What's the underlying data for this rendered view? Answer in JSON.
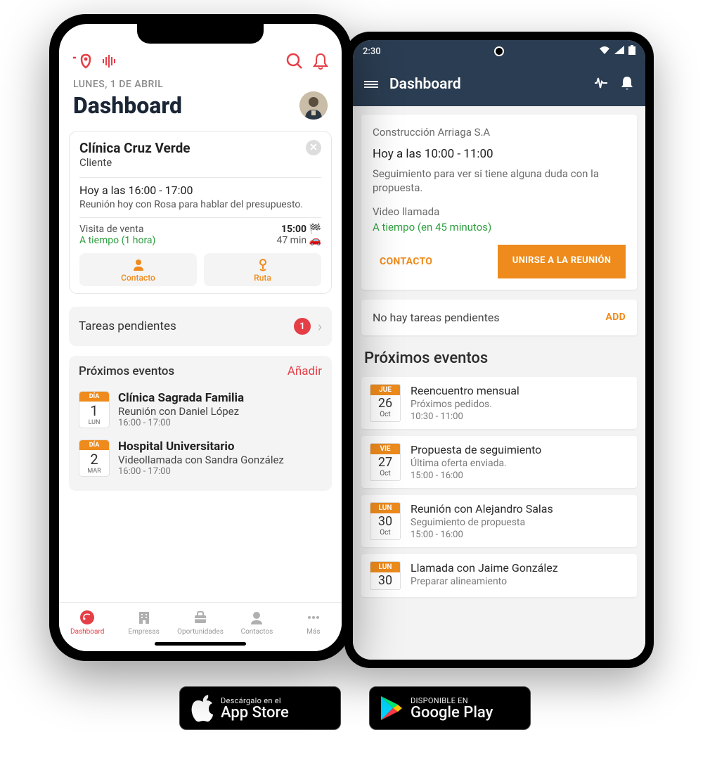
{
  "ios": {
    "date_label": "LUNES, 1 DE ABRIL",
    "title": "Dashboard",
    "card": {
      "client": "Clínica Cruz Verde",
      "client_type": "Cliente",
      "time": "Hoy a las 16:00 - 17:00",
      "desc": "Reunión hoy con Rosa para hablar del presupuesto.",
      "type": "Visita de venta",
      "status": "A tiempo (1 hora)",
      "leave_at": "15:00",
      "travel": "47 min",
      "contact_btn": "Contacto",
      "route_btn": "Ruta"
    },
    "pending": {
      "label": "Tareas pendientes",
      "count": "1"
    },
    "events_section": {
      "title": "Próximos eventos",
      "add": "Añadir",
      "items": [
        {
          "dow": "DÍA",
          "day": "1",
          "mon": "LUN",
          "title": "Clínica Sagrada Familia",
          "sub": "Reunión con Daniel López",
          "time": "16:00 - 17:00"
        },
        {
          "dow": "DÍA",
          "day": "2",
          "mon": "MAR",
          "title": "Hospital Universitario",
          "sub": "Videollamada con Sandra González",
          "time": "16:00 - 17:00"
        }
      ]
    },
    "tabbar": {
      "dashboard": "Dashboard",
      "companies": "Empresas",
      "opportunities": "Oportunidades",
      "contacts": "Contactos",
      "more": "Más"
    }
  },
  "android": {
    "time": "2:30",
    "title": "Dashboard",
    "card": {
      "client": "Construcción Arriaga S.A",
      "time": "Hoy a las 10:00 - 11:00",
      "desc": "Seguimiento para ver si tiene alguna duda con la propuesta.",
      "type": "Video llamada",
      "status": "A tiempo (en 45 minutos)",
      "contact_btn": "CONTACTO",
      "join_btn": "UNIRSE A LA REUNIÓN"
    },
    "pending": {
      "label": "No hay tareas pendientes",
      "add": "ADD"
    },
    "events_section": {
      "title": "Próximos eventos",
      "items": [
        {
          "dow": "JUE",
          "day": "26",
          "mon": "Oct",
          "title": "Reencuentro mensual",
          "sub": "Próximos pedidos.",
          "time": "10:30 - 11:00"
        },
        {
          "dow": "VIE",
          "day": "27",
          "mon": "Oct",
          "title": "Propuesta de seguimiento",
          "sub": "Última oferta enviada.",
          "time": "15:00 - 16:00"
        },
        {
          "dow": "LUN",
          "day": "30",
          "mon": "Oct",
          "title": "Reunión con Alejandro Salas",
          "sub": "Seguimiento de propuesta",
          "time": "15:00 - 16:00"
        },
        {
          "dow": "LUN",
          "day": "30",
          "mon": "",
          "title": "Llamada con Jaime González",
          "sub": "Preparar alineamiento",
          "time": ""
        }
      ]
    }
  },
  "stores": {
    "apple": {
      "top": "Descárgalo en el",
      "bot": "App Store"
    },
    "google": {
      "top": "DISPONIBLE EN",
      "bot": "Google Play"
    }
  }
}
